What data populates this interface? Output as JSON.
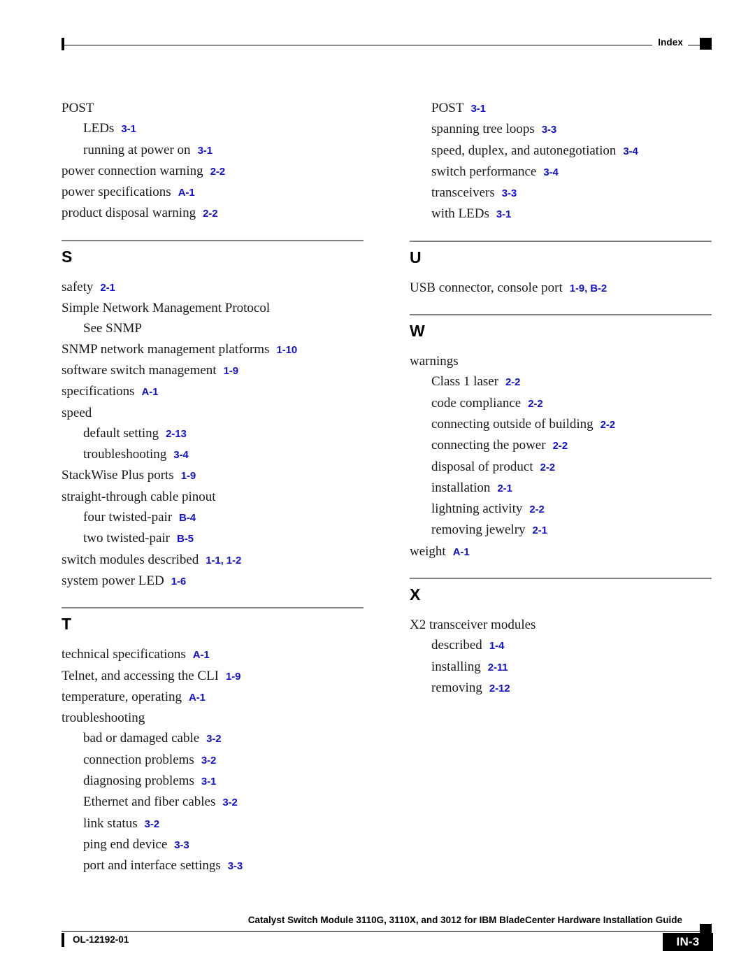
{
  "header": {
    "label": "Index",
    "marker_icon": "black-square-marker"
  },
  "footer": {
    "doc_number": "OL-12192-01",
    "book_title": "Catalyst Switch Module 3110G, 3110X, and 3012 for IBM BladeCenter Hardware Installation Guide",
    "page_number": "IN-3",
    "marker_icon": "black-square-marker"
  },
  "colors": {
    "page_reference": "#1111d4",
    "section_rule": "#808080",
    "text": "#000000"
  },
  "columns": [
    {
      "name": "left-column",
      "sections": [
        {
          "letter": "",
          "show_rule": false,
          "entries": [
            {
              "level": 0,
              "term": "POST",
              "ref": ""
            },
            {
              "level": 1,
              "term": "LEDs",
              "ref": "3-1"
            },
            {
              "level": 1,
              "term": "running at power on",
              "ref": "3-1"
            },
            {
              "level": 0,
              "term": "power connection warning",
              "ref": "2-2"
            },
            {
              "level": 0,
              "term": "power specifications",
              "ref": "A-1"
            },
            {
              "level": 0,
              "term": "product disposal warning",
              "ref": "2-2"
            }
          ]
        },
        {
          "letter": "S",
          "show_rule": true,
          "entries": [
            {
              "level": 0,
              "term": "safety",
              "ref": "2-1"
            },
            {
              "level": 0,
              "term": "Simple Network Management Protocol",
              "ref": ""
            },
            {
              "level": 1,
              "term": "See SNMP",
              "ref": ""
            },
            {
              "level": 0,
              "term": "SNMP network management platforms",
              "ref": "1-10"
            },
            {
              "level": 0,
              "term": "software switch management",
              "ref": "1-9"
            },
            {
              "level": 0,
              "term": "specifications",
              "ref": "A-1"
            },
            {
              "level": 0,
              "term": "speed",
              "ref": ""
            },
            {
              "level": 1,
              "term": "default setting",
              "ref": "2-13"
            },
            {
              "level": 1,
              "term": "troubleshooting",
              "ref": "3-4"
            },
            {
              "level": 0,
              "term": "StackWise Plus ports",
              "ref": "1-9"
            },
            {
              "level": 0,
              "term": "straight-through cable pinout",
              "ref": ""
            },
            {
              "level": 1,
              "term": "four twisted-pair",
              "ref": "B-4"
            },
            {
              "level": 1,
              "term": "two twisted-pair",
              "ref": "B-5"
            },
            {
              "level": 0,
              "term": "switch modules described",
              "ref": "1-1, 1-2"
            },
            {
              "level": 0,
              "term": "system power LED",
              "ref": "1-6"
            }
          ]
        },
        {
          "letter": "T",
          "show_rule": true,
          "entries": [
            {
              "level": 0,
              "term": "technical specifications",
              "ref": "A-1"
            },
            {
              "level": 0,
              "term": "Telnet, and accessing the CLI",
              "ref": "1-9"
            },
            {
              "level": 0,
              "term": "temperature, operating",
              "ref": "A-1"
            },
            {
              "level": 0,
              "term": "troubleshooting",
              "ref": ""
            },
            {
              "level": 1,
              "term": "bad or damaged cable",
              "ref": "3-2"
            },
            {
              "level": 1,
              "term": "connection problems",
              "ref": "3-2"
            },
            {
              "level": 1,
              "term": "diagnosing problems",
              "ref": "3-1"
            },
            {
              "level": 1,
              "term": "Ethernet and fiber cables",
              "ref": "3-2"
            },
            {
              "level": 1,
              "term": "link status",
              "ref": "3-2"
            },
            {
              "level": 1,
              "term": "ping end device",
              "ref": "3-3"
            },
            {
              "level": 1,
              "term": "port and interface settings",
              "ref": "3-3"
            }
          ]
        }
      ]
    },
    {
      "name": "right-column",
      "sections": [
        {
          "letter": "",
          "show_rule": false,
          "entries": [
            {
              "level": 1,
              "term": "POST",
              "ref": "3-1"
            },
            {
              "level": 1,
              "term": "spanning tree loops",
              "ref": "3-3"
            },
            {
              "level": 1,
              "term": "speed, duplex, and autonegotiation",
              "ref": "3-4"
            },
            {
              "level": 1,
              "term": "switch performance",
              "ref": "3-4"
            },
            {
              "level": 1,
              "term": "transceivers",
              "ref": "3-3"
            },
            {
              "level": 1,
              "term": "with LEDs",
              "ref": "3-1"
            }
          ]
        },
        {
          "letter": "U",
          "show_rule": true,
          "entries": [
            {
              "level": 0,
              "term": "USB connector, console port",
              "ref": "1-9, B-2"
            }
          ]
        },
        {
          "letter": "W",
          "show_rule": true,
          "entries": [
            {
              "level": 0,
              "term": "warnings",
              "ref": ""
            },
            {
              "level": 1,
              "term": "Class 1 laser",
              "ref": "2-2"
            },
            {
              "level": 1,
              "term": "code compliance",
              "ref": "2-2"
            },
            {
              "level": 1,
              "term": "connecting outside of building",
              "ref": "2-2"
            },
            {
              "level": 1,
              "term": "connecting the power",
              "ref": "2-2"
            },
            {
              "level": 1,
              "term": "disposal of product",
              "ref": "2-2"
            },
            {
              "level": 1,
              "term": "installation",
              "ref": "2-1"
            },
            {
              "level": 1,
              "term": "lightning activity",
              "ref": "2-2"
            },
            {
              "level": 1,
              "term": "removing jewelry",
              "ref": "2-1"
            },
            {
              "level": 0,
              "term": "weight",
              "ref": "A-1"
            }
          ]
        },
        {
          "letter": "X",
          "show_rule": true,
          "entries": [
            {
              "level": 0,
              "term": "X2 transceiver modules",
              "ref": ""
            },
            {
              "level": 1,
              "term": "described",
              "ref": "1-4"
            },
            {
              "level": 1,
              "term": "installing",
              "ref": "2-11"
            },
            {
              "level": 1,
              "term": "removing",
              "ref": "2-12"
            }
          ]
        }
      ]
    }
  ]
}
